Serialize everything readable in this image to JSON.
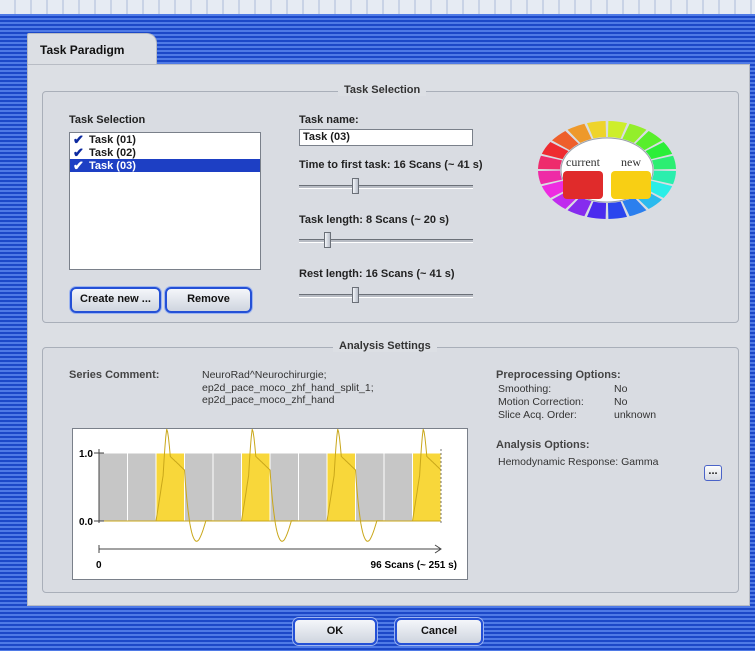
{
  "tab": {
    "label": "Task Paradigm"
  },
  "task_selection": {
    "group_title": "Task Selection",
    "list_label": "Task Selection",
    "tasks": [
      {
        "label": "Task (01)",
        "checked": true,
        "selected": false
      },
      {
        "label": "Task (02)",
        "checked": true,
        "selected": false
      },
      {
        "label": "Task (03)",
        "checked": true,
        "selected": true
      }
    ],
    "create_button": "Create new ...",
    "remove_button": "Remove",
    "task_name_label": "Task name:",
    "task_name_value": "Task (03)",
    "time_to_first_label": "Time to first task:  16 Scans (~ 41 s)",
    "time_to_first_level": 0.32,
    "task_length_label": "Task length:  8 Scans (~ 20 s)",
    "task_length_level": 0.15,
    "rest_length_label": "Rest length:  16 Scans (~ 41 s)",
    "rest_length_level": 0.32,
    "wheel_current_label": "current",
    "wheel_new_label": "new",
    "current_color": "#e02b2b",
    "new_color": "#f8cf14"
  },
  "analysis": {
    "group_title": "Analysis Settings",
    "series_comment_label": "Series Comment:",
    "series_comment_lines": [
      "NeuroRad^Neurochirurgie;",
      "ep2d_pace_moco_zhf_hand_split_1;",
      "ep2d_pace_moco_zhf_hand"
    ],
    "preprocessing_title": "Preprocessing Options:",
    "preprocessing": [
      {
        "name": "Smoothing:",
        "value": "No"
      },
      {
        "name": "Motion Correction:",
        "value": "No"
      },
      {
        "name": "Slice Acq. Order:",
        "value": "unknown"
      }
    ],
    "analysis_options_title": "Analysis Options:",
    "hemodynamic": "Hemodynamic Response: Gamma",
    "ellipsis_label": "...",
    "plot": {
      "y_top_label": "1.0",
      "y_bottom_label": "0.0",
      "x_start_label": "0",
      "x_end_label": "96 Scans (~ 251 s)",
      "total_scans": 96,
      "block_scans": 8,
      "task_color": "#f8d73a",
      "rest_color": "#c6c6c6"
    }
  },
  "footer": {
    "ok_label": "OK",
    "cancel_label": "Cancel"
  }
}
